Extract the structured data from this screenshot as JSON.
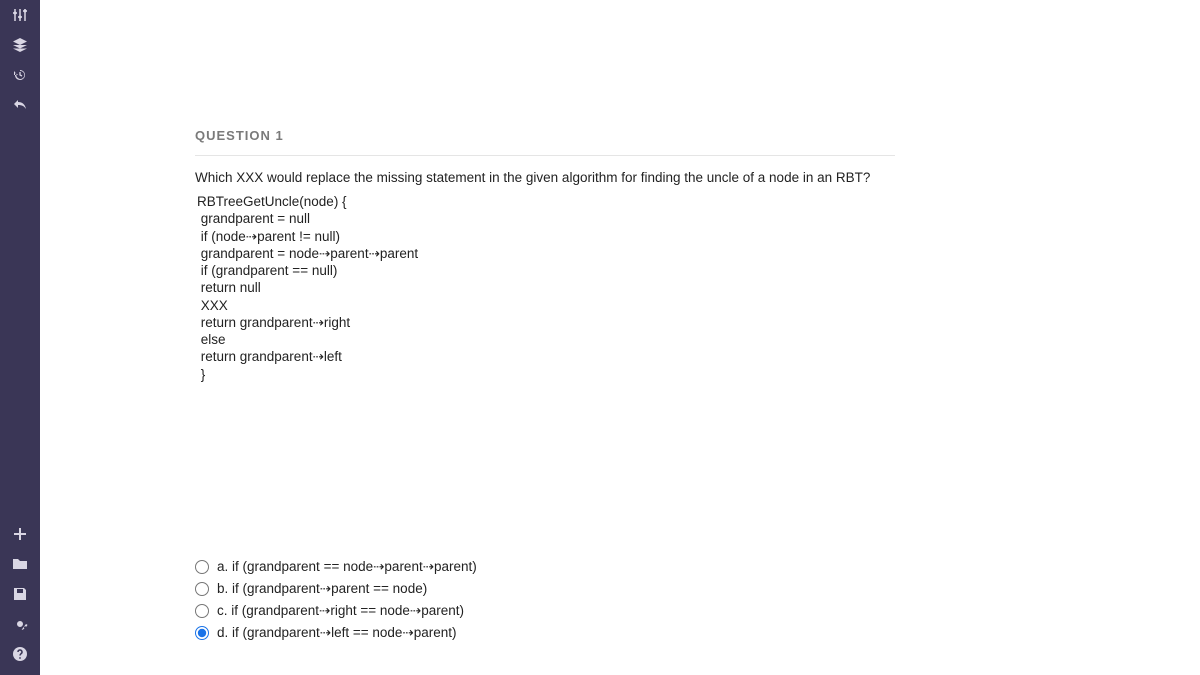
{
  "sidebar": {
    "top": [
      {
        "name": "adjust-icon"
      },
      {
        "name": "layers-icon"
      },
      {
        "name": "history-icon"
      },
      {
        "name": "undo-icon"
      }
    ],
    "bottom": [
      {
        "name": "plus-icon"
      },
      {
        "name": "folder-icon"
      },
      {
        "name": "save-icon"
      },
      {
        "name": "settings-icon"
      },
      {
        "name": "help-icon"
      }
    ]
  },
  "question": {
    "title": "QUESTION 1",
    "prompt": "Which XXX would replace the missing statement in the given algorithm for finding the uncle of a node in an RBT?",
    "code": "RBTreeGetUncle(node) {\n grandparent = null\n if (node⇢parent != null)\n grandparent = node⇢parent⇢parent\n if (grandparent == null)\n return null\n XXX\n return grandparent⇢right\n else\n return grandparent⇢left\n }",
    "options": [
      {
        "id": "a",
        "label": "a. if (grandparent == node⇢parent⇢parent)",
        "selected": false
      },
      {
        "id": "b",
        "label": "b. if (grandparent⇢parent == node)",
        "selected": false
      },
      {
        "id": "c",
        "label": "c. if (grandparent⇢right == node⇢parent)",
        "selected": false
      },
      {
        "id": "d",
        "label": "d. if (grandparent⇢left == node⇢parent)",
        "selected": true
      }
    ]
  }
}
